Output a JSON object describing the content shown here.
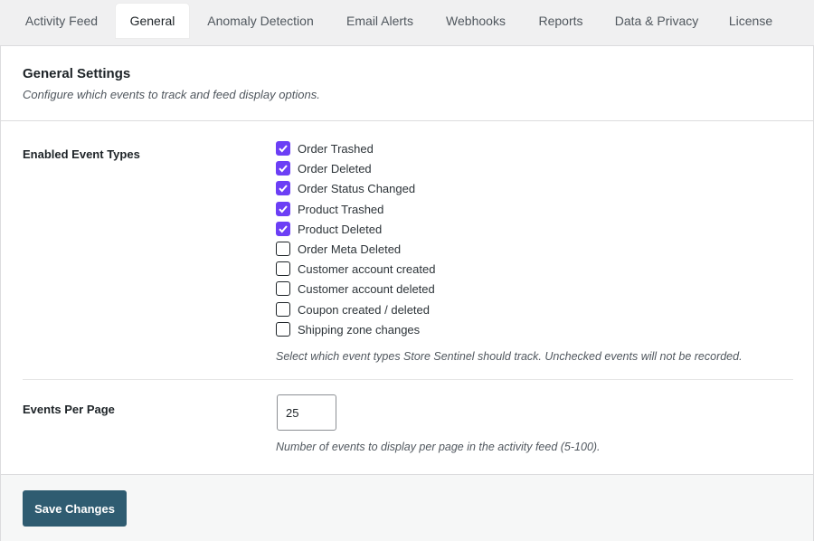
{
  "tabs": [
    {
      "label": "Activity Feed",
      "active": false
    },
    {
      "label": "General",
      "active": true
    },
    {
      "label": "Anomaly Detection",
      "active": false
    },
    {
      "label": "Email Alerts",
      "active": false
    },
    {
      "label": "Webhooks",
      "active": false
    },
    {
      "label": "Reports",
      "active": false
    },
    {
      "label": "Data & Privacy",
      "active": false
    },
    {
      "label": "License",
      "active": false
    }
  ],
  "section": {
    "title": "General Settings",
    "description": "Configure which events to track and feed display options."
  },
  "event_types": {
    "label": "Enabled Event Types",
    "options": [
      {
        "label": "Order Trashed",
        "checked": true
      },
      {
        "label": "Order Deleted",
        "checked": true
      },
      {
        "label": "Order Status Changed",
        "checked": true
      },
      {
        "label": "Product Trashed",
        "checked": true
      },
      {
        "label": "Product Deleted",
        "checked": true
      },
      {
        "label": "Order Meta Deleted",
        "checked": false
      },
      {
        "label": "Customer account created",
        "checked": false
      },
      {
        "label": "Customer account deleted",
        "checked": false
      },
      {
        "label": "Coupon created / deleted",
        "checked": false
      },
      {
        "label": "Shipping zone changes",
        "checked": false
      }
    ],
    "help": "Select which event types Store Sentinel should track. Unchecked events will not be recorded."
  },
  "events_per_page": {
    "label": "Events Per Page",
    "value": "25",
    "help": "Number of events to display per page in the activity feed (5-100)."
  },
  "footer": {
    "save_label": "Save Changes"
  },
  "colors": {
    "checkbox_accent": "#6c3ff5",
    "save_button": "#2f5c71"
  }
}
